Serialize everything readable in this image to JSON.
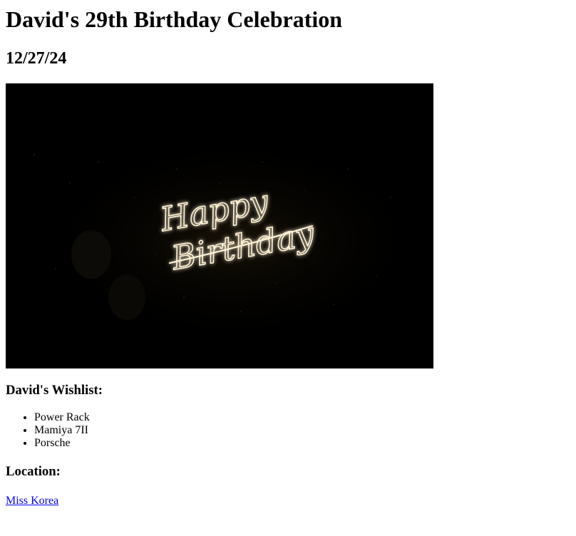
{
  "header": {
    "title": "David's 29th Birthday Celebration",
    "date": "12/27/24"
  },
  "hero_image": {
    "sign_line_1": "Happy",
    "sign_line_2": "Birthday",
    "background_color": "#000000",
    "neon_color": "#fff3d6"
  },
  "wishlist": {
    "heading": "David's Wishlist:",
    "items": [
      "Power Rack",
      "Mamiya 7II",
      "Porsche"
    ]
  },
  "location": {
    "heading": "Location:",
    "link_text": "Miss Korea",
    "link_color": "#0000ee"
  }
}
